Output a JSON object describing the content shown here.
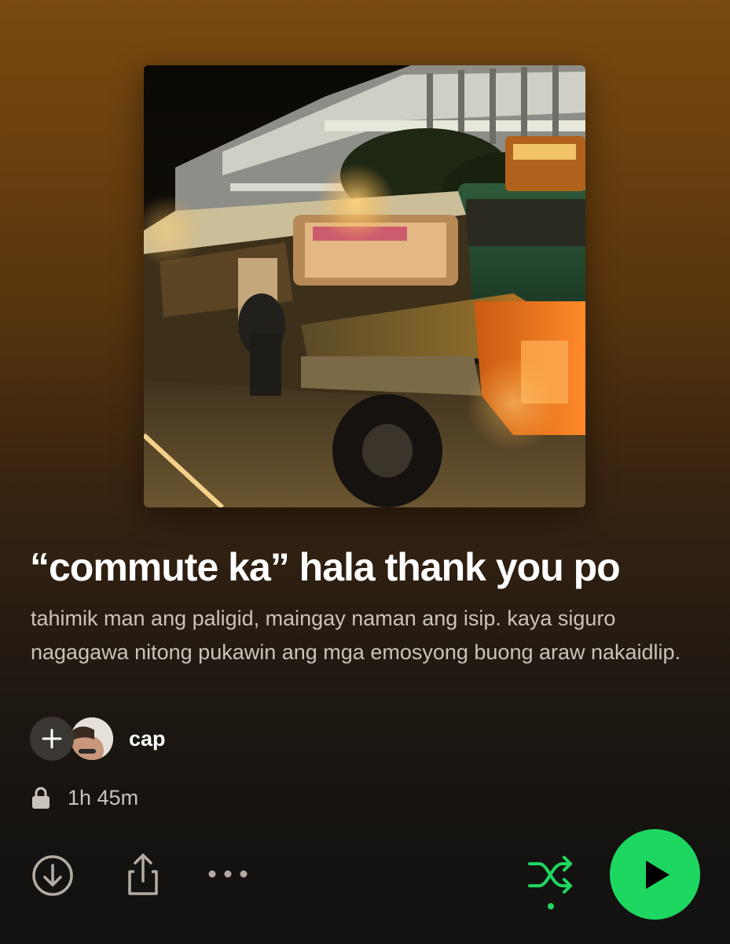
{
  "playlist": {
    "cover_alt": "playlist cover photo: jeepney at night",
    "title": "“commute ka” hala thank you po",
    "description": "tahimik man ang paligid, maingay naman ang isip. kaya siguro nagagawa nitong pukawin ang mga emosyong buong araw nakaidlip.",
    "owner": "cap",
    "duration": "1h 45m",
    "visibility_icon": "lock-icon"
  },
  "actions": {
    "add_collaborator_icon": "plus-icon",
    "download_icon": "download-circle-icon",
    "share_icon": "share-icon",
    "more_icon": "more-dots-icon",
    "shuffle_icon": "shuffle-icon",
    "play_icon": "play-icon"
  },
  "colors": {
    "accent_green": "#1ed760",
    "header_brown": "#7a4a10",
    "background_dark": "#121212",
    "secondary_text": "#c9c3bb"
  }
}
